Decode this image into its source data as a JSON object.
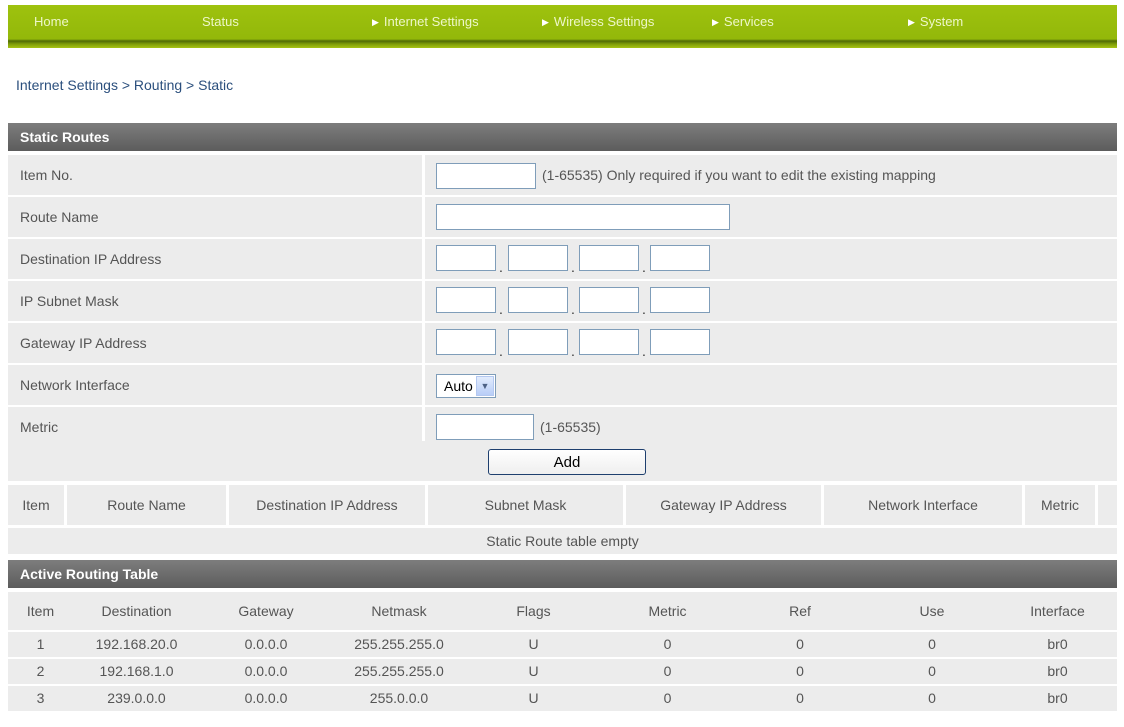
{
  "nav": {
    "items": [
      {
        "label": "Home",
        "arrow": false
      },
      {
        "label": "Status",
        "arrow": false
      },
      {
        "label": "Internet Settings",
        "arrow": true
      },
      {
        "label": "Wireless Settings",
        "arrow": true
      },
      {
        "label": "Services",
        "arrow": true
      },
      {
        "label": "System",
        "arrow": true
      }
    ],
    "arrow_glyph": "▶"
  },
  "breadcrumb": "Internet Settings > Routing > Static",
  "static_routes": {
    "title": "Static Routes",
    "item_no": {
      "label": "Item No.",
      "value": "",
      "hint": "(1-65535)  Only required if you want to edit the existing mapping"
    },
    "route_name": {
      "label": "Route Name",
      "value": ""
    },
    "dest_ip": {
      "label": "Destination IP Address",
      "octets": [
        "",
        "",
        "",
        ""
      ]
    },
    "subnet_mask": {
      "label": "IP Subnet Mask",
      "octets": [
        "",
        "",
        "",
        ""
      ]
    },
    "gateway_ip": {
      "label": "Gateway IP Address",
      "octets": [
        "",
        "",
        "",
        ""
      ]
    },
    "network_interface": {
      "label": "Network Interface",
      "selected": "Auto"
    },
    "metric": {
      "label": "Metric",
      "value": "",
      "hint": "(1-65535)"
    },
    "add_label": "Add",
    "table": {
      "headers": [
        "Item",
        "Route Name",
        "Destination IP Address",
        "Subnet Mask",
        "Gateway IP Address",
        "Network Interface",
        "Metric"
      ],
      "empty_message": "Static Route table empty"
    }
  },
  "active_routing": {
    "title": "Active Routing Table",
    "headers": [
      "Item",
      "Destination",
      "Gateway",
      "Netmask",
      "Flags",
      "Metric",
      "Ref",
      "Use",
      "Interface"
    ],
    "rows": [
      [
        "1",
        "192.168.20.0",
        "0.0.0.0",
        "255.255.255.0",
        "U",
        "0",
        "0",
        "0",
        "br0"
      ],
      [
        "2",
        "192.168.1.0",
        "0.0.0.0",
        "255.255.255.0",
        "U",
        "0",
        "0",
        "0",
        "br0"
      ],
      [
        "3",
        "239.0.0.0",
        "0.0.0.0",
        "255.0.0.0",
        "U",
        "0",
        "0",
        "0",
        "br0"
      ]
    ]
  },
  "colors": {
    "nav_green": "#9ec20e",
    "header_gray": "#6d6d6d",
    "row_gray": "#ececec",
    "link_blue": "#2b4f7d"
  }
}
